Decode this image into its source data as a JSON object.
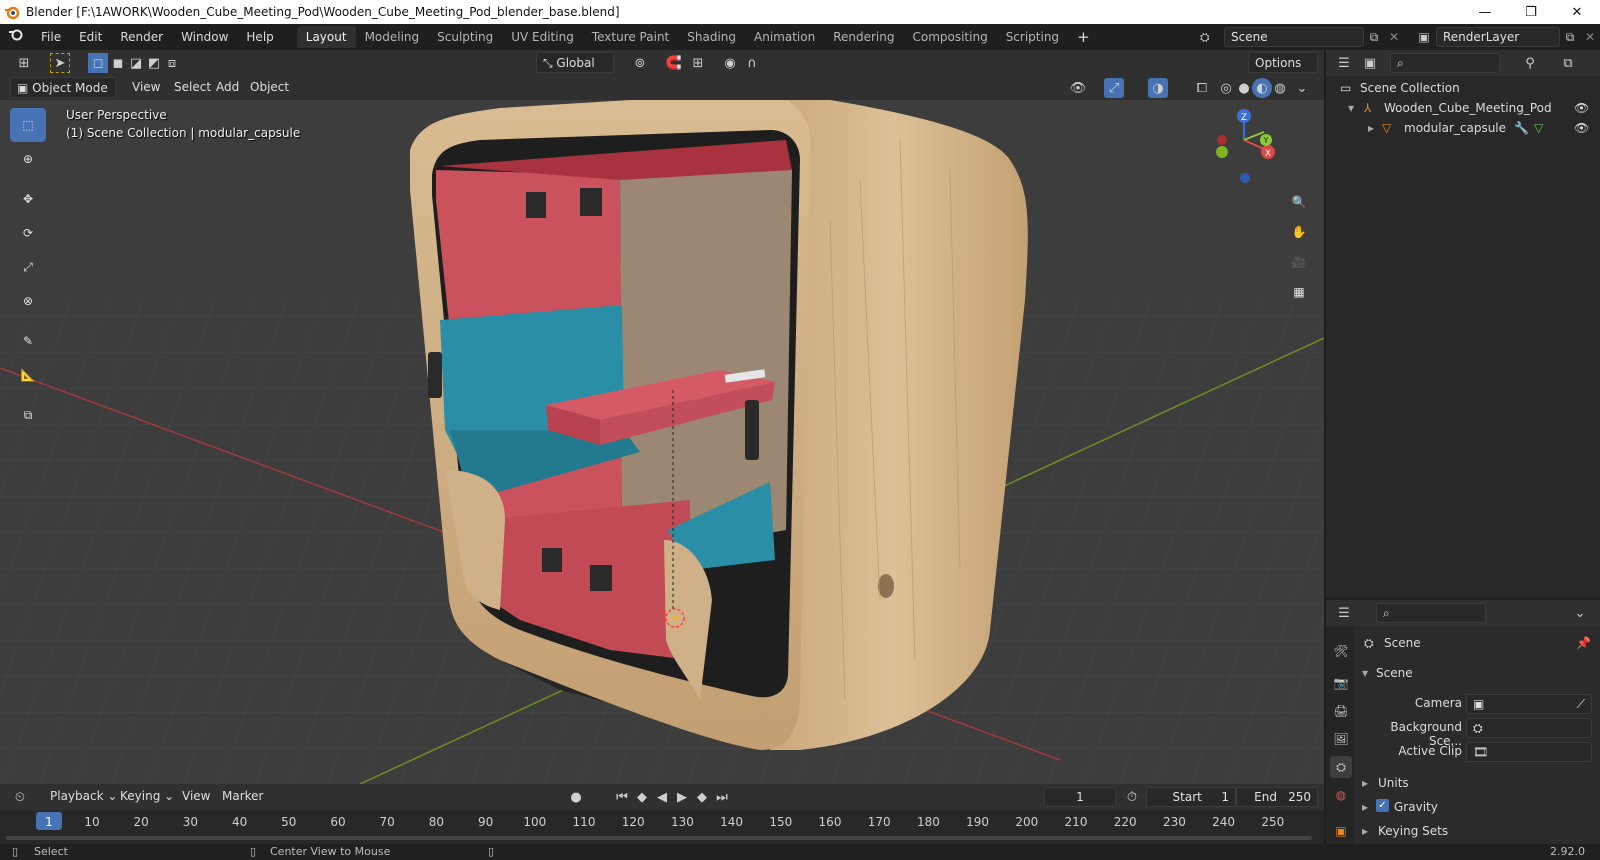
{
  "window": {
    "title": "Blender [F:\\1AWORK\\Wooden_Cube_Meeting_Pod\\Wooden_Cube_Meeting_Pod_blender_base.blend]",
    "min": "—",
    "max": "❐",
    "close": "✕"
  },
  "menu": [
    "File",
    "Edit",
    "Render",
    "Window",
    "Help"
  ],
  "workspaces": [
    "Layout",
    "Modeling",
    "Sculpting",
    "UV Editing",
    "Texture Paint",
    "Shading",
    "Animation",
    "Rendering",
    "Compositing",
    "Scripting"
  ],
  "active_workspace": "Layout",
  "scene_field": "Scene",
  "renderlayer_field": "RenderLayer",
  "toolheader": {
    "orientation": "Global",
    "options": "Options"
  },
  "viewheader": {
    "mode": "Object Mode",
    "menus": [
      "View",
      "Select",
      "Add",
      "Object"
    ]
  },
  "viewport": {
    "perspective": "User Perspective",
    "collection_info": "(1) Scene Collection | modular_capsule",
    "gizmo": {
      "z": "Z",
      "y": "Y",
      "x": "X"
    }
  },
  "outliner": {
    "root": "Scene Collection",
    "items": [
      {
        "label": "Wooden_Cube_Meeting_Pod",
        "depth": 1
      },
      {
        "label": "modular_capsule",
        "depth": 2
      }
    ]
  },
  "properties": {
    "context": "Scene",
    "panel": "Scene",
    "fields": [
      {
        "label": "Camera",
        "value": ""
      },
      {
        "label": "Background Sce...",
        "value": ""
      },
      {
        "label": "Active Clip",
        "value": ""
      }
    ],
    "collapsed_panels": [
      "Units",
      "Gravity",
      "Keying Sets"
    ],
    "gravity_checked": true
  },
  "timeline": {
    "menus": [
      "Playback",
      "Keying",
      "View",
      "Marker"
    ],
    "current_frame": "1",
    "start_label": "Start",
    "start": "1",
    "end_label": "End",
    "end": "250",
    "ruler": [
      "1",
      "10",
      "20",
      "30",
      "40",
      "50",
      "60",
      "70",
      "80",
      "90",
      "100",
      "110",
      "120",
      "130",
      "140",
      "150",
      "160",
      "170",
      "180",
      "190",
      "200",
      "210",
      "220",
      "230",
      "240",
      "250"
    ]
  },
  "status": {
    "select": "Select",
    "center_view": "Center View to Mouse",
    "version": "2.92.0"
  },
  "colors": {
    "accent": "#4772b3",
    "header": "#303030",
    "viewport": "#3d3d3d",
    "wood": "#d4b589",
    "interior_red": "#c9525d",
    "cushion": "#2a8fa6"
  }
}
